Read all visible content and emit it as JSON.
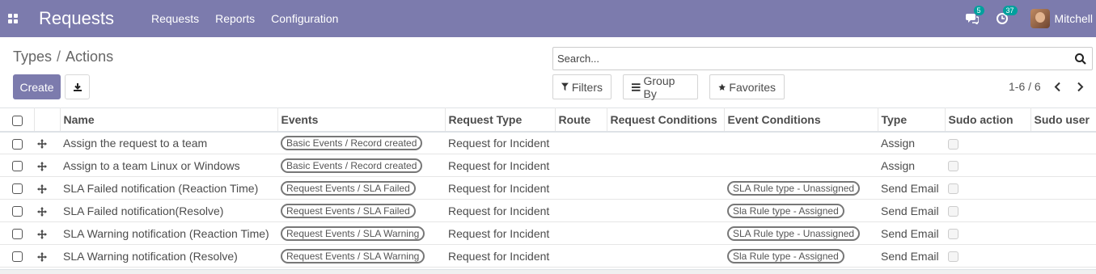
{
  "navbar": {
    "brand": "Requests",
    "menu": [
      "Requests",
      "Reports",
      "Configuration"
    ],
    "messages_count": "5",
    "activities_count": "37",
    "user_name": "Mitchell"
  },
  "breadcrumb": {
    "parent": "Types",
    "separator": "/",
    "current": "Actions"
  },
  "buttons": {
    "create": "Create"
  },
  "search": {
    "placeholder": "Search..."
  },
  "filters": {
    "filters": "Filters",
    "group_by": "Group By",
    "favorites": "Favorites"
  },
  "pager": {
    "value": "1-6 / 6"
  },
  "table": {
    "columns": [
      "Name",
      "Events",
      "Request Type",
      "Route",
      "Request Conditions",
      "Event Conditions",
      "Type",
      "Sudo action",
      "Sudo user"
    ],
    "rows": [
      {
        "name": "Assign the request to a team",
        "events": "Basic Events / Record created",
        "request_type": "Request for Incident",
        "route": "",
        "request_conditions": "",
        "event_conditions": "",
        "type": "Assign"
      },
      {
        "name": "Assign to a team Linux or Windows",
        "events": "Basic Events / Record created",
        "request_type": "Request for Incident",
        "route": "",
        "request_conditions": "",
        "event_conditions": "",
        "type": "Assign"
      },
      {
        "name": "SLA Failed notification (Reaction Time)",
        "events": "Request Events / SLA Failed",
        "request_type": "Request for Incident",
        "route": "",
        "request_conditions": "",
        "event_conditions": "SLA Rule type - Unassigned",
        "type": "Send Email"
      },
      {
        "name": "SLA Failed notification(Resolve)",
        "events": "Request Events / SLA Failed",
        "request_type": "Request for Incident",
        "route": "",
        "request_conditions": "",
        "event_conditions": "Sla Rule type - Assigned",
        "type": "Send Email"
      },
      {
        "name": "SLA Warning notification (Reaction Time)",
        "events": "Request Events / SLA Warning",
        "request_type": "Request for Incident",
        "route": "",
        "request_conditions": "",
        "event_conditions": "SLA Rule type - Unassigned",
        "type": "Send Email"
      },
      {
        "name": "SLA Warning notification (Resolve)",
        "events": "Request Events / SLA Warning",
        "request_type": "Request for Incident",
        "route": "",
        "request_conditions": "",
        "event_conditions": "Sla Rule type - Assigned",
        "type": "Send Email"
      }
    ]
  },
  "icons": {
    "apps": "apps-grid-icon",
    "messages": "chat-bubbles-icon",
    "activities": "clock-icon",
    "download": "download-icon",
    "search": "search-icon",
    "filter": "funnel-icon",
    "group_by": "bars-icon",
    "favorites": "star-icon",
    "prev": "chevron-left-icon",
    "next": "chevron-right-icon",
    "handle": "drag-handle-icon"
  },
  "colors": {
    "navbar": "#7c7bad",
    "primary": "#7c7bad",
    "badge": "#00a09d"
  }
}
